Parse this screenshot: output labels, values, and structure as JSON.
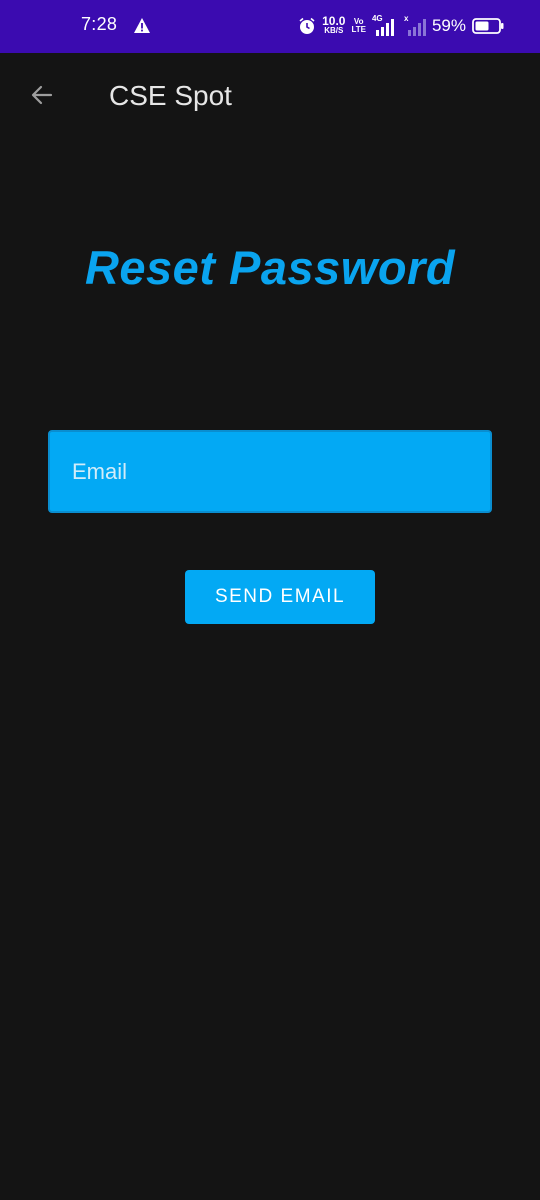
{
  "status_bar": {
    "time": "7:28",
    "alert_icon": "warning-icon",
    "alarm_icon": "alarm-clock-icon",
    "net_speed_value": "10.0",
    "net_speed_unit": "KB/S",
    "volte_top": "Vo",
    "volte_bottom": "LTE",
    "network_type": "4G",
    "sim2_label": "x",
    "battery_percent": "59%",
    "battery_level": 0.59,
    "background_color": "#3b0bb0"
  },
  "app_bar": {
    "back_icon": "arrow-left-icon",
    "title": "CSE Spot"
  },
  "main": {
    "heading": "Reset Password",
    "email_field": {
      "placeholder": "Email",
      "value": ""
    },
    "send_button_label": "SEND EMAIL"
  },
  "colors": {
    "background": "#141414",
    "accent": "#03a9f4",
    "heading": "#0aa4ef",
    "status_bar": "#3b0bb0"
  }
}
